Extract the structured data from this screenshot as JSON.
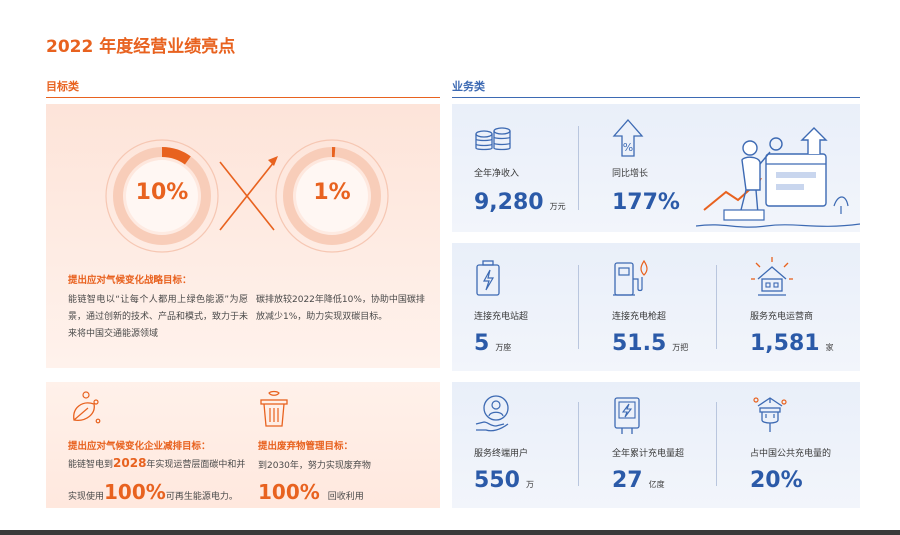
{
  "page": {
    "title": "2022 年度经营业绩亮点"
  },
  "sections": {
    "target_label": "目标类",
    "business_label": "业务类"
  },
  "target": {
    "ring_left_value": "10%",
    "ring_right_value": "1%",
    "strategy_title": "提出应对气候变化战略目标：",
    "strategy_text_1": "能链智电以“让每个人都用上绿色能源”为愿景，通过创新的技术、产品和模式，致力于未来将中国交通能源领域",
    "strategy_text_2": "碳排放较2022年降低10%，协助中国碳排放减少1%，助力实现双碳目标。",
    "emission": {
      "title": "提出应对气候变化企业减排目标：",
      "line1_prefix": "能链智电到",
      "line1_year": "2028",
      "line1_suffix": "年实现运营层面碳中和并",
      "line2_prefix": "实现使用",
      "line2_value": "100%",
      "line2_suffix": "可再生能源电力。"
    },
    "waste": {
      "title": "提出废弃物管理目标：",
      "line1": "到2030年，努力实现废弃物",
      "value": "100%",
      "suffix": "回收利用"
    }
  },
  "business": {
    "revenue": {
      "label": "全年净收入",
      "value": "9,280",
      "unit": "万元"
    },
    "growth": {
      "label": "同比增长",
      "value": "177%"
    },
    "stations": {
      "label": "连接充电站超",
      "value": "5",
      "unit": "万座"
    },
    "chargers": {
      "label": "连接充电枪超",
      "value": "51.5",
      "unit": "万把"
    },
    "operators": {
      "label": "服务充电运营商",
      "value": "1,581",
      "unit": "家"
    },
    "users": {
      "label": "服务终端用户",
      "value": "550",
      "unit": "万"
    },
    "volume": {
      "label": "全年累计充电量超",
      "value": "27",
      "unit": "亿度"
    },
    "share": {
      "label": "占中国公共充电量的",
      "value": "20%"
    }
  },
  "colors": {
    "orange": "#e8621f",
    "blue": "#2b5aa8",
    "panel_orange": "#fde4d9",
    "panel_blue": "#e9eff9"
  }
}
